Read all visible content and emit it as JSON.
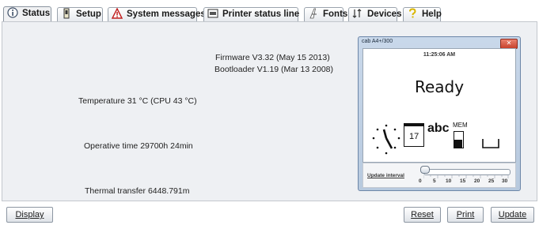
{
  "tabs": [
    {
      "label": "Status",
      "icon": "info-icon",
      "active": true
    },
    {
      "label": "Setup",
      "icon": "printer-small-icon"
    },
    {
      "label": "System messages",
      "icon": "warning-icon"
    },
    {
      "label": "Printer status line",
      "icon": "status-line-icon"
    },
    {
      "label": "Fonts",
      "icon": "font-icon"
    },
    {
      "label": "Devices",
      "icon": "devices-icon"
    },
    {
      "label": "Help",
      "icon": "help-icon"
    }
  ],
  "status": {
    "firmware": "Firmware V3.32 (May 15 2013)",
    "bootloader": "Bootloader V1.19 (Mar 13 2008)",
    "temperature": "Temperature 31 °C (CPU 43 °C)",
    "operative_time": "Operative time 29700h 24min",
    "thermal_transfer": "Thermal transfer 6448.791m"
  },
  "device_window": {
    "title": "cab A4+/300",
    "time": "11:25:06 AM",
    "state": "Ready",
    "calendar_day": "17",
    "abc": "abc",
    "mem": "MEM",
    "update_interval_label": "Update interval",
    "update_interval_value": 0,
    "tick_labels": [
      "0",
      "5",
      "10",
      "15",
      "20",
      "25",
      "30"
    ]
  },
  "buttons": {
    "display": "Display",
    "reset": "Reset",
    "print": "Print",
    "update": "Update"
  }
}
